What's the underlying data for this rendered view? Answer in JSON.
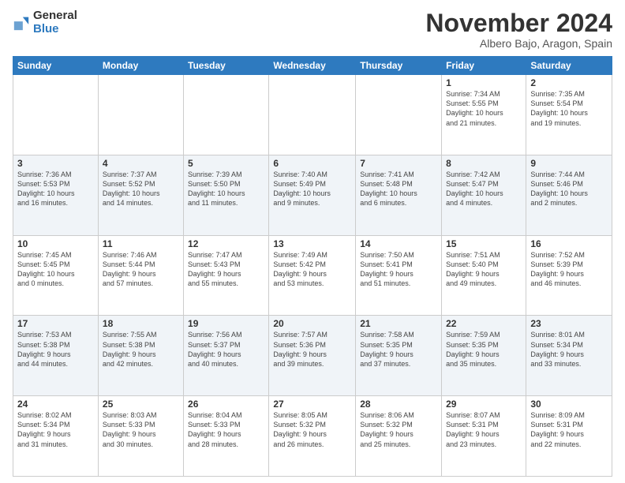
{
  "logo": {
    "general": "General",
    "blue": "Blue"
  },
  "header": {
    "title": "November 2024",
    "subtitle": "Albero Bajo, Aragon, Spain"
  },
  "weekdays": [
    "Sunday",
    "Monday",
    "Tuesday",
    "Wednesday",
    "Thursday",
    "Friday",
    "Saturday"
  ],
  "weeks": [
    [
      {
        "day": "",
        "info": ""
      },
      {
        "day": "",
        "info": ""
      },
      {
        "day": "",
        "info": ""
      },
      {
        "day": "",
        "info": ""
      },
      {
        "day": "",
        "info": ""
      },
      {
        "day": "1",
        "info": "Sunrise: 7:34 AM\nSunset: 5:55 PM\nDaylight: 10 hours\nand 21 minutes."
      },
      {
        "day": "2",
        "info": "Sunrise: 7:35 AM\nSunset: 5:54 PM\nDaylight: 10 hours\nand 19 minutes."
      }
    ],
    [
      {
        "day": "3",
        "info": "Sunrise: 7:36 AM\nSunset: 5:53 PM\nDaylight: 10 hours\nand 16 minutes."
      },
      {
        "day": "4",
        "info": "Sunrise: 7:37 AM\nSunset: 5:52 PM\nDaylight: 10 hours\nand 14 minutes."
      },
      {
        "day": "5",
        "info": "Sunrise: 7:39 AM\nSunset: 5:50 PM\nDaylight: 10 hours\nand 11 minutes."
      },
      {
        "day": "6",
        "info": "Sunrise: 7:40 AM\nSunset: 5:49 PM\nDaylight: 10 hours\nand 9 minutes."
      },
      {
        "day": "7",
        "info": "Sunrise: 7:41 AM\nSunset: 5:48 PM\nDaylight: 10 hours\nand 6 minutes."
      },
      {
        "day": "8",
        "info": "Sunrise: 7:42 AM\nSunset: 5:47 PM\nDaylight: 10 hours\nand 4 minutes."
      },
      {
        "day": "9",
        "info": "Sunrise: 7:44 AM\nSunset: 5:46 PM\nDaylight: 10 hours\nand 2 minutes."
      }
    ],
    [
      {
        "day": "10",
        "info": "Sunrise: 7:45 AM\nSunset: 5:45 PM\nDaylight: 10 hours\nand 0 minutes."
      },
      {
        "day": "11",
        "info": "Sunrise: 7:46 AM\nSunset: 5:44 PM\nDaylight: 9 hours\nand 57 minutes."
      },
      {
        "day": "12",
        "info": "Sunrise: 7:47 AM\nSunset: 5:43 PM\nDaylight: 9 hours\nand 55 minutes."
      },
      {
        "day": "13",
        "info": "Sunrise: 7:49 AM\nSunset: 5:42 PM\nDaylight: 9 hours\nand 53 minutes."
      },
      {
        "day": "14",
        "info": "Sunrise: 7:50 AM\nSunset: 5:41 PM\nDaylight: 9 hours\nand 51 minutes."
      },
      {
        "day": "15",
        "info": "Sunrise: 7:51 AM\nSunset: 5:40 PM\nDaylight: 9 hours\nand 49 minutes."
      },
      {
        "day": "16",
        "info": "Sunrise: 7:52 AM\nSunset: 5:39 PM\nDaylight: 9 hours\nand 46 minutes."
      }
    ],
    [
      {
        "day": "17",
        "info": "Sunrise: 7:53 AM\nSunset: 5:38 PM\nDaylight: 9 hours\nand 44 minutes."
      },
      {
        "day": "18",
        "info": "Sunrise: 7:55 AM\nSunset: 5:38 PM\nDaylight: 9 hours\nand 42 minutes."
      },
      {
        "day": "19",
        "info": "Sunrise: 7:56 AM\nSunset: 5:37 PM\nDaylight: 9 hours\nand 40 minutes."
      },
      {
        "day": "20",
        "info": "Sunrise: 7:57 AM\nSunset: 5:36 PM\nDaylight: 9 hours\nand 39 minutes."
      },
      {
        "day": "21",
        "info": "Sunrise: 7:58 AM\nSunset: 5:35 PM\nDaylight: 9 hours\nand 37 minutes."
      },
      {
        "day": "22",
        "info": "Sunrise: 7:59 AM\nSunset: 5:35 PM\nDaylight: 9 hours\nand 35 minutes."
      },
      {
        "day": "23",
        "info": "Sunrise: 8:01 AM\nSunset: 5:34 PM\nDaylight: 9 hours\nand 33 minutes."
      }
    ],
    [
      {
        "day": "24",
        "info": "Sunrise: 8:02 AM\nSunset: 5:34 PM\nDaylight: 9 hours\nand 31 minutes."
      },
      {
        "day": "25",
        "info": "Sunrise: 8:03 AM\nSunset: 5:33 PM\nDaylight: 9 hours\nand 30 minutes."
      },
      {
        "day": "26",
        "info": "Sunrise: 8:04 AM\nSunset: 5:33 PM\nDaylight: 9 hours\nand 28 minutes."
      },
      {
        "day": "27",
        "info": "Sunrise: 8:05 AM\nSunset: 5:32 PM\nDaylight: 9 hours\nand 26 minutes."
      },
      {
        "day": "28",
        "info": "Sunrise: 8:06 AM\nSunset: 5:32 PM\nDaylight: 9 hours\nand 25 minutes."
      },
      {
        "day": "29",
        "info": "Sunrise: 8:07 AM\nSunset: 5:31 PM\nDaylight: 9 hours\nand 23 minutes."
      },
      {
        "day": "30",
        "info": "Sunrise: 8:09 AM\nSunset: 5:31 PM\nDaylight: 9 hours\nand 22 minutes."
      }
    ]
  ]
}
